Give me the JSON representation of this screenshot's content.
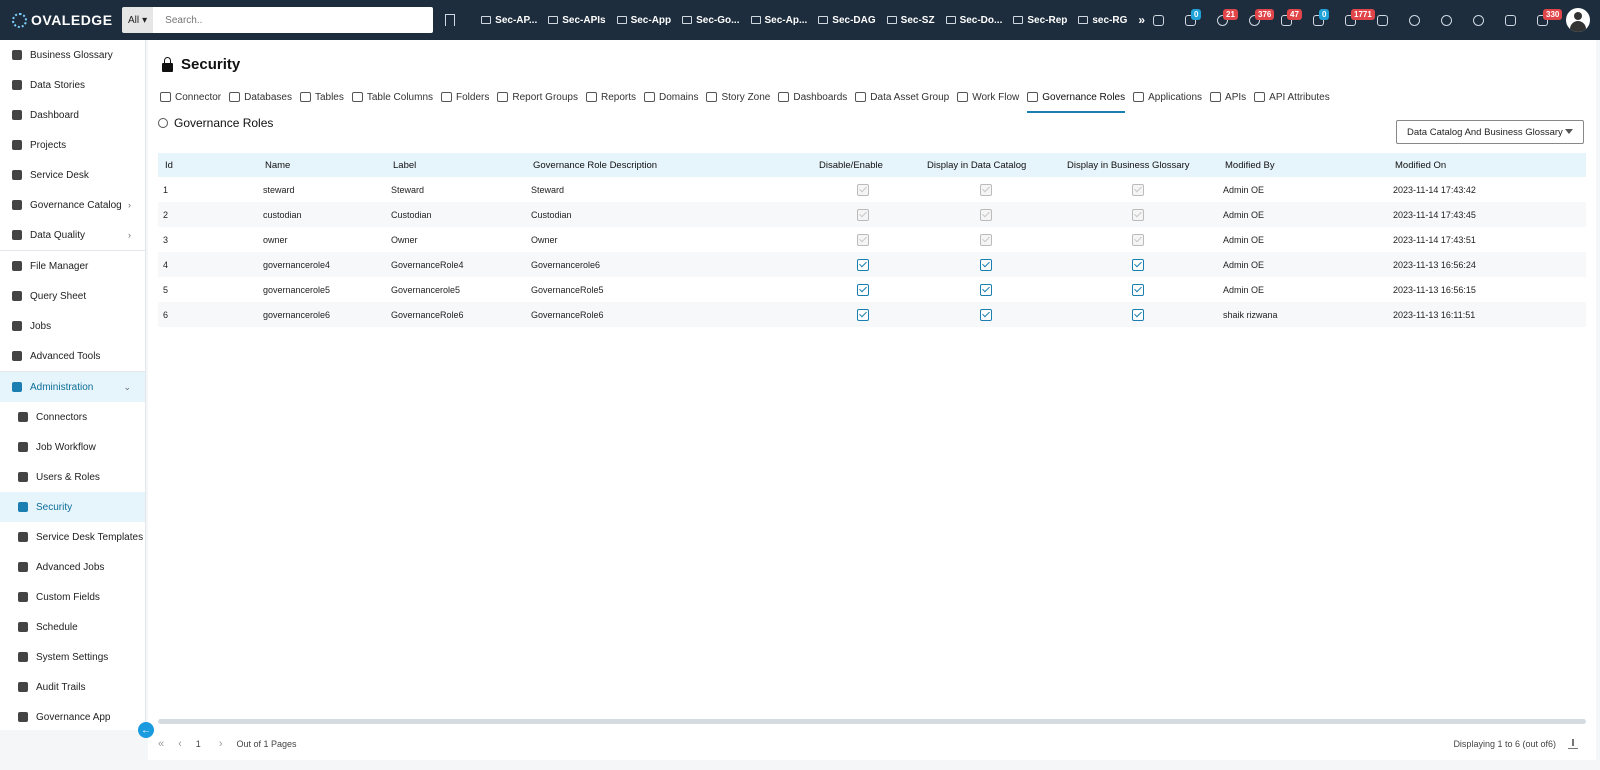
{
  "brand": {
    "logo_text": "OVALEDGE"
  },
  "search": {
    "scope": "All",
    "placeholder": "Search.."
  },
  "folders": [
    "Sec-AP...",
    "Sec-APIs",
    "Sec-App",
    "Sec-Go...",
    "Sec-Ap...",
    "Sec-DAG",
    "Sec-SZ",
    "Sec-Do...",
    "Sec-Rep",
    "sec-RG"
  ],
  "more_folders": "»",
  "top_icons": [
    {
      "icon": "cloud-upload-icon",
      "badge": ""
    },
    {
      "icon": "tasks-icon",
      "badge": "0",
      "badge_color": "#1fa2d8"
    },
    {
      "icon": "database-alert-icon",
      "badge": "21",
      "badge_color": "#e0454a"
    },
    {
      "icon": "alert-icon",
      "badge": "376",
      "badge_color": "#e0454a"
    },
    {
      "icon": "report-icon",
      "badge": "47",
      "badge_color": "#e0454a"
    },
    {
      "icon": "access-lock-icon",
      "badge": "0",
      "badge_color": "#1fa2d8"
    },
    {
      "icon": "api-icon",
      "badge": "1771",
      "badge_color": "#e0454a"
    },
    {
      "icon": "like-icon",
      "badge": ""
    },
    {
      "icon": "info-icon",
      "badge": ""
    },
    {
      "icon": "chrome-icon",
      "badge": ""
    },
    {
      "icon": "help-icon",
      "badge": ""
    },
    {
      "icon": "expand-icon",
      "badge": ""
    },
    {
      "icon": "messages-icon",
      "badge": "330",
      "badge_color": "#e0454a"
    }
  ],
  "sidebar": {
    "items": [
      {
        "label": "Business Glossary",
        "icon": "book-icon"
      },
      {
        "label": "Data Stories",
        "icon": "map-icon"
      },
      {
        "label": "Dashboard",
        "icon": "dashboard-icon"
      },
      {
        "label": "Projects",
        "icon": "clipboard-icon"
      },
      {
        "label": "Service Desk",
        "icon": "service-desk-icon"
      },
      {
        "label": "Governance Catalog",
        "icon": "bank-icon",
        "chevron": "›"
      },
      {
        "label": "Data Quality",
        "icon": "data-quality-icon",
        "chevron": "›"
      },
      {
        "label": "File Manager",
        "icon": "file-manager-icon"
      },
      {
        "label": "Query Sheet",
        "icon": "query-sheet-icon"
      },
      {
        "label": "Jobs",
        "icon": "jobs-icon"
      },
      {
        "label": "Advanced Tools",
        "icon": "tools-icon"
      },
      {
        "label": "Administration",
        "icon": "administration-icon",
        "chevron": "⌄"
      }
    ],
    "sub_items": [
      {
        "label": "Connectors",
        "icon": "connectors-icon"
      },
      {
        "label": "Job Workflow",
        "icon": "workflow-icon"
      },
      {
        "label": "Users & Roles",
        "icon": "users-icon"
      },
      {
        "label": "Security",
        "icon": "lock-icon",
        "active": true
      },
      {
        "label": "Service Desk Templates",
        "icon": "template-icon"
      },
      {
        "label": "Advanced Jobs",
        "icon": "advanced-jobs-icon"
      },
      {
        "label": "Custom Fields",
        "icon": "custom-fields-icon"
      },
      {
        "label": "Schedule",
        "icon": "calendar-icon"
      },
      {
        "label": "System Settings",
        "icon": "wrench-icon"
      },
      {
        "label": "Audit Trails",
        "icon": "hourglass-icon"
      },
      {
        "label": "Governance App",
        "icon": "app-icon"
      }
    ],
    "collapse_glyph": "←"
  },
  "page": {
    "title": "Security"
  },
  "tabs": [
    "Connector",
    "Databases",
    "Tables",
    "Table Columns",
    "Folders",
    "Report Groups",
    "Reports",
    "Domains",
    "Story Zone",
    "Dashboards",
    "Data Asset Group",
    "Work Flow",
    "Governance Roles",
    "Applications",
    "APIs",
    "API Attributes"
  ],
  "active_tab": "Governance Roles",
  "section": {
    "title": "Governance Roles"
  },
  "filter": {
    "selected": "Data Catalog And Business Glossary"
  },
  "table": {
    "columns": [
      "Id",
      "Name",
      "Label",
      "Governance Role Description",
      "Disable/Enable",
      "Display in Data Catalog",
      "Display in Business Glossary",
      "Modified By",
      "Modified On"
    ],
    "rows": [
      {
        "id": "1",
        "name": "steward",
        "label": "Steward",
        "desc": "Steward",
        "enable": false,
        "catalog": false,
        "glossary": false,
        "modified_by": "Admin OE",
        "modified_on": "2023-11-14 17:43:42"
      },
      {
        "id": "2",
        "name": "custodian",
        "label": "Custodian",
        "desc": "Custodian",
        "enable": false,
        "catalog": false,
        "glossary": false,
        "modified_by": "Admin OE",
        "modified_on": "2023-11-14 17:43:45"
      },
      {
        "id": "3",
        "name": "owner",
        "label": "Owner",
        "desc": "Owner",
        "enable": false,
        "catalog": false,
        "glossary": false,
        "modified_by": "Admin OE",
        "modified_on": "2023-11-14 17:43:51"
      },
      {
        "id": "4",
        "name": "governancerole4",
        "label": "GovernanceRole4",
        "desc": "Governancerole6",
        "enable": true,
        "catalog": true,
        "glossary": true,
        "modified_by": "Admin OE",
        "modified_on": "2023-11-13 16:56:24"
      },
      {
        "id": "5",
        "name": "governancerole5",
        "label": "Governancerole5",
        "desc": "GovernanceRole5",
        "enable": true,
        "catalog": true,
        "glossary": true,
        "modified_by": "Admin OE",
        "modified_on": "2023-11-13 16:56:15"
      },
      {
        "id": "6",
        "name": "governancerole6",
        "label": "GovernanceRole6",
        "desc": "GovernanceRole6",
        "enable": true,
        "catalog": true,
        "glossary": true,
        "modified_by": "shaik rizwana",
        "modified_on": "2023-11-13 16:11:51"
      }
    ]
  },
  "pager": {
    "first": "«",
    "prev": "‹",
    "page": "1",
    "next": "›",
    "info": "Out of 1 Pages",
    "summary": "Displaying 1 to 6  (out of6)"
  }
}
